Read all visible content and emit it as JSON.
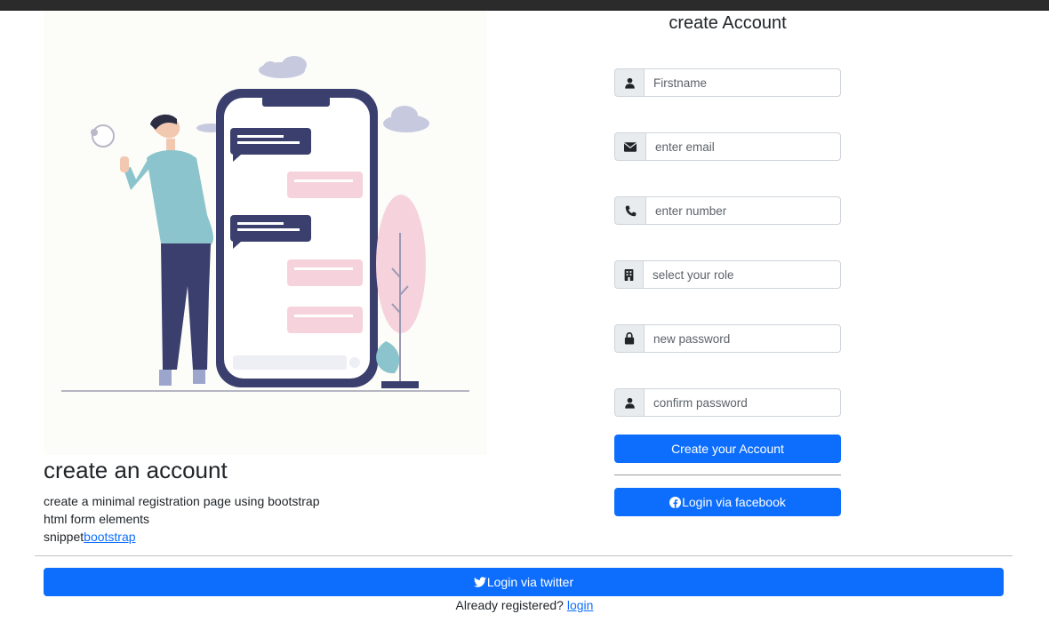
{
  "left": {
    "title": "create an account",
    "desc_line1": "create a minimal registration page using bootstrap",
    "desc_line2": "html form elements",
    "desc_line3_prefix": "snippet",
    "desc_link": "bootstrap"
  },
  "form": {
    "title": "create Account",
    "fields": [
      {
        "icon": "user-icon",
        "placeholder": "Firstname"
      },
      {
        "icon": "envelope-icon",
        "placeholder": "enter email"
      },
      {
        "icon": "phone-icon",
        "placeholder": "enter number"
      },
      {
        "icon": "building-icon",
        "placeholder": "select your role"
      },
      {
        "icon": "lock-icon",
        "placeholder": "new password"
      },
      {
        "icon": "user-icon",
        "placeholder": "confirm password"
      }
    ],
    "submit_label": "Create your Account",
    "facebook_label": "Login via facebook"
  },
  "footer": {
    "twitter_label": "Login via twitter",
    "already_text": "Already registered?",
    "login_link": "login"
  },
  "colors": {
    "primary": "#0d6efd",
    "illustration_navy": "#3b3f6e",
    "illustration_teal": "#8bc4cc",
    "illustration_pink": "#f6d3dc"
  }
}
